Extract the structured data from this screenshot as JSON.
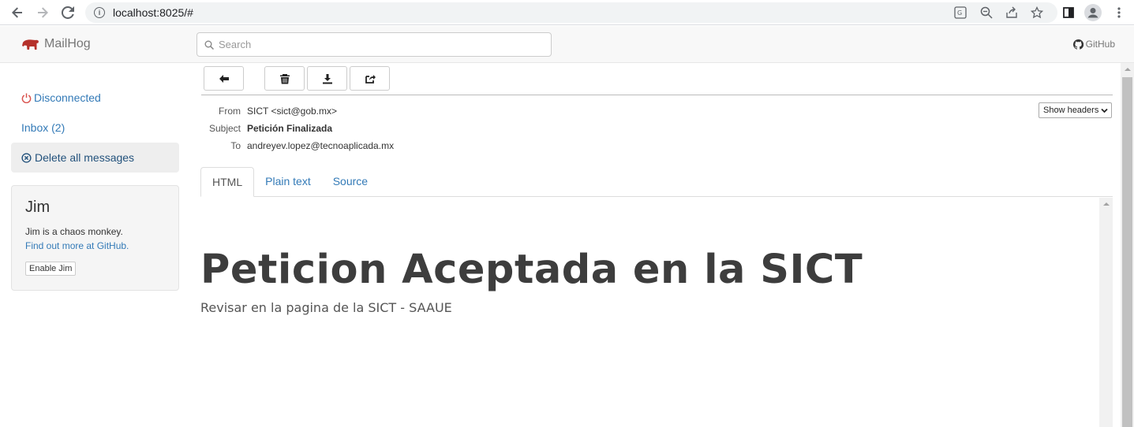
{
  "browser": {
    "url": "localhost:8025/#",
    "icons": [
      "back-arrow-icon",
      "forward-arrow-icon",
      "reload-icon",
      "site-info-icon",
      "translate-icon",
      "zoom-icon",
      "share-icon",
      "bookmark-star-icon",
      "sidebar-icon",
      "profile-icon",
      "menu-dots-icon"
    ]
  },
  "header": {
    "brand": "MailHog",
    "search_placeholder": "Search",
    "github_label": "GitHub"
  },
  "sidebar": {
    "status": "Disconnected",
    "inbox": "Inbox (2)",
    "delete_all": "Delete all messages",
    "jim": {
      "title": "Jim",
      "description": "Jim is a chaos monkey.",
      "link": "Find out more at GitHub.",
      "button": "Enable Jim"
    }
  },
  "toolbar": {
    "buttons": [
      "back-icon",
      "trash-icon",
      "download-icon",
      "release-icon"
    ]
  },
  "message": {
    "from_label": "From",
    "from": "SICT <sict@gob.mx>",
    "subject_label": "Subject",
    "subject": "Petición Finalizada",
    "to_label": "To",
    "to": "andreyev.lopez@tecnoaplicada.mx",
    "show_headers": "Show headers"
  },
  "tabs": [
    "HTML",
    "Plain text",
    "Source"
  ],
  "body": {
    "heading": "Peticion Aceptada en la SICT",
    "text": "Revisar en la pagina de la SICT - SAAUE"
  },
  "colors": {
    "link": "#337ab7",
    "danger": "#d9534f",
    "brand_logo": "#b5312b"
  }
}
